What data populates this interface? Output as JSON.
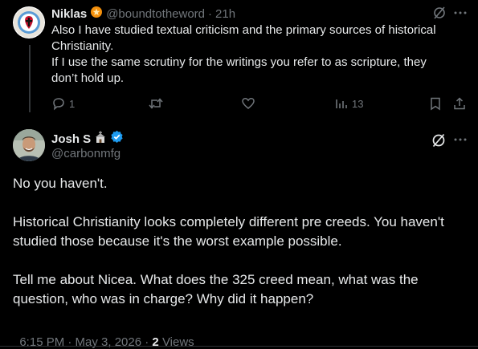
{
  "reply_parent": {
    "author_name": "Niklas",
    "handle": "@boundtotheword",
    "separator": "·",
    "time": "21h",
    "text_lines": [
      "Also I have studied textual criticism and the primary sources of historical",
      "Christianity.",
      "If I use the same scrutiny for the writings you refer to as scripture, they",
      "don’t hold up."
    ],
    "reply_count": "1",
    "views_count": "13"
  },
  "main_post": {
    "author_name": "Josh S",
    "handle": "@carbonmfg",
    "paragraphs": [
      "No you haven't.",
      "Historical Christianity looks completely different pre creeds. You haven't studied those because it's the worst example possible.",
      "Tell me about Nicea. What does the 325 creed mean, what was the question, who was in charge? Why did it happen?"
    ],
    "timestamp": "6:15 PM · May 3, 2026 · ",
    "views_count": "2",
    "views_label": "Views"
  },
  "colors": {
    "background": "#000000",
    "text": "#e7e9ea",
    "muted": "#71767b",
    "verified": "#1d9bf0",
    "badge_orange": "#f4900c"
  },
  "icons": [
    "grok-icon",
    "more-icon",
    "reply-icon",
    "retweet-icon",
    "like-icon",
    "views-icon",
    "bookmark-icon",
    "share-icon",
    "verified-badge-icon",
    "church-emoji-icon",
    "badge-icon"
  ]
}
